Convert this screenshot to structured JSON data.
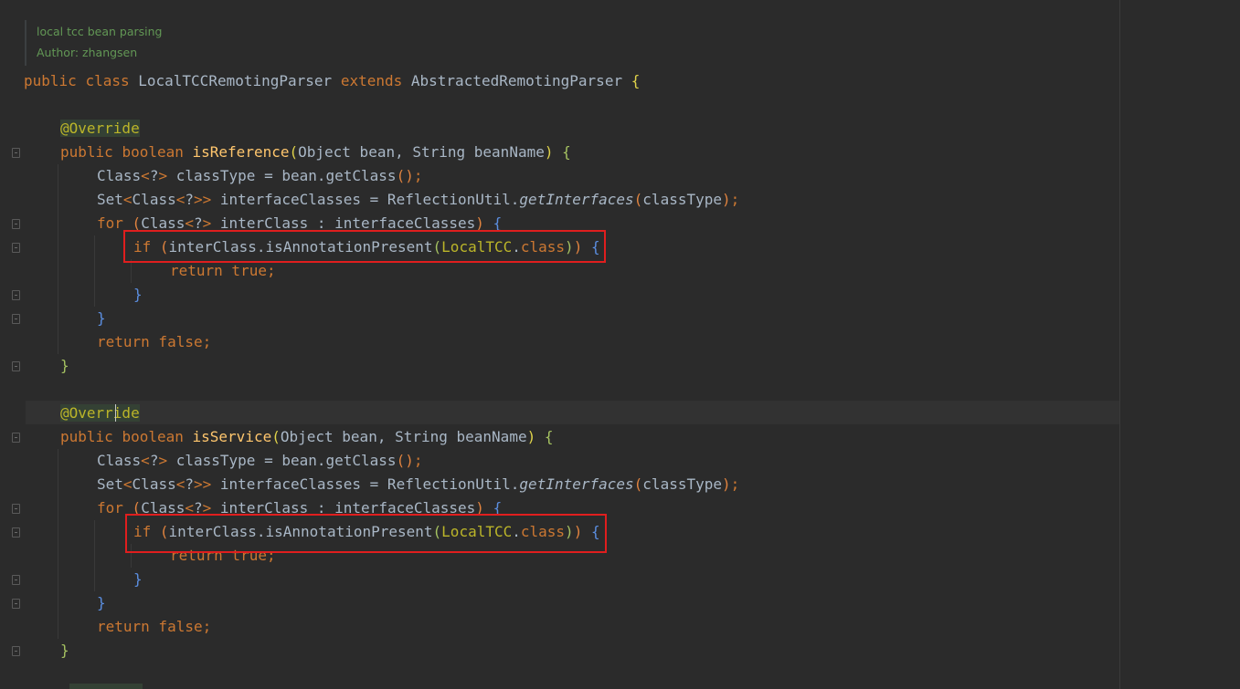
{
  "doc": {
    "line1": "local tcc bean parsing",
    "line2": "Author: zhangsen"
  },
  "code": {
    "class_decl": {
      "public": "public",
      "class": "class",
      "name": "LocalTCCRemotingParser",
      "extends": "extends",
      "parent": "AbstractedRemotingParser",
      "brace": "{"
    },
    "methods": [
      {
        "annotation": "@Override",
        "public": "public",
        "type": "boolean",
        "name": "isReference",
        "params": "Object bean, String beanName",
        "line_classType": "classType = bean.getClass",
        "line_set_type": "Set",
        "line_set_rest": "interfaceClasses = ReflectionUtil.",
        "line_set_call": "getInterfaces",
        "line_set_arg": "classType",
        "for_kw": "for",
        "for_rest": "interClass : interfaceClasses",
        "if_kw": "if",
        "if_cond": "interClass.isAnnotationPresent",
        "if_arg": "LocalTCC",
        "if_class": "class",
        "return_true": "return true;",
        "return_false": "return false;"
      },
      {
        "annotation": "@Override",
        "public": "public",
        "type": "boolean",
        "name": "isService",
        "params": "Object bean, String beanName",
        "line_classType": "classType = bean.getClass",
        "line_set_type": "Set",
        "line_set_rest": "interfaceClasses = ReflectionUtil.",
        "line_set_call": "getInterfaces",
        "line_set_arg": "classType",
        "for_kw": "for",
        "for_rest": "interClass : interfaceClasses",
        "if_kw": "if",
        "if_cond": "interClass.isAnnotationPresent",
        "if_arg": "LocalTCC",
        "if_class": "class",
        "return_true": "return true;",
        "return_false": "return false;"
      }
    ]
  },
  "colors": {
    "background": "#2b2b2b",
    "keyword": "#cc7832",
    "text": "#a9b7c6",
    "method": "#ffc66d",
    "annotation": "#bbb529",
    "doc": "#629755",
    "highlight": "#e01e1e"
  },
  "highlights": [
    "isReference if-condition",
    "isService if-condition"
  ]
}
